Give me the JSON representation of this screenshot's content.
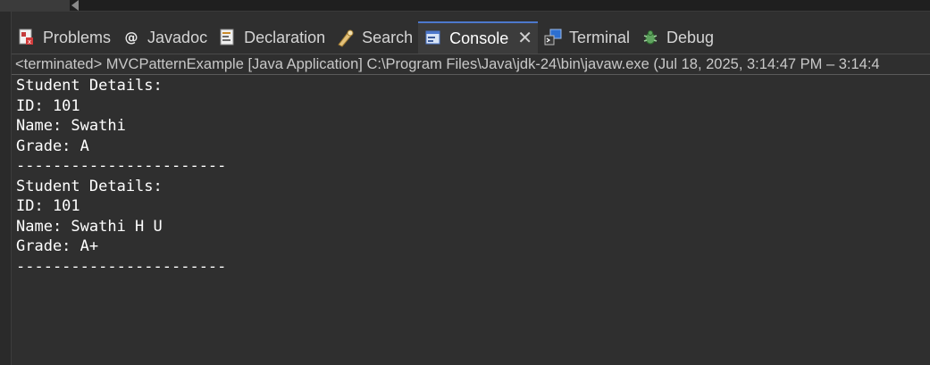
{
  "tabs": [
    {
      "label": "Problems",
      "icon": "problems-icon"
    },
    {
      "label": "Javadoc",
      "icon": "javadoc-icon"
    },
    {
      "label": "Declaration",
      "icon": "declaration-icon"
    },
    {
      "label": "Search",
      "icon": "search-icon"
    },
    {
      "label": "Console",
      "icon": "console-icon",
      "active": true
    },
    {
      "label": "Terminal",
      "icon": "terminal-icon"
    },
    {
      "label": "Debug",
      "icon": "debug-icon"
    }
  ],
  "console": {
    "header": "<terminated> MVCPatternExample [Java Application] C:\\Program Files\\Java\\jdk-24\\bin\\javaw.exe  (Jul 18, 2025, 3:14:47 PM – 3:14:4",
    "lines": [
      "Student Details:",
      "ID: 101",
      "Name: Swathi",
      "Grade: A",
      "-----------------------",
      "Student Details:",
      "ID: 101",
      "Name: Swathi H U",
      "Grade: A+",
      "-----------------------"
    ]
  },
  "colors": {
    "background": "#2f2f2f",
    "active_tab": "#3c3c3c",
    "active_tab_accent": "#4d78cc",
    "text": "#ffffff"
  }
}
